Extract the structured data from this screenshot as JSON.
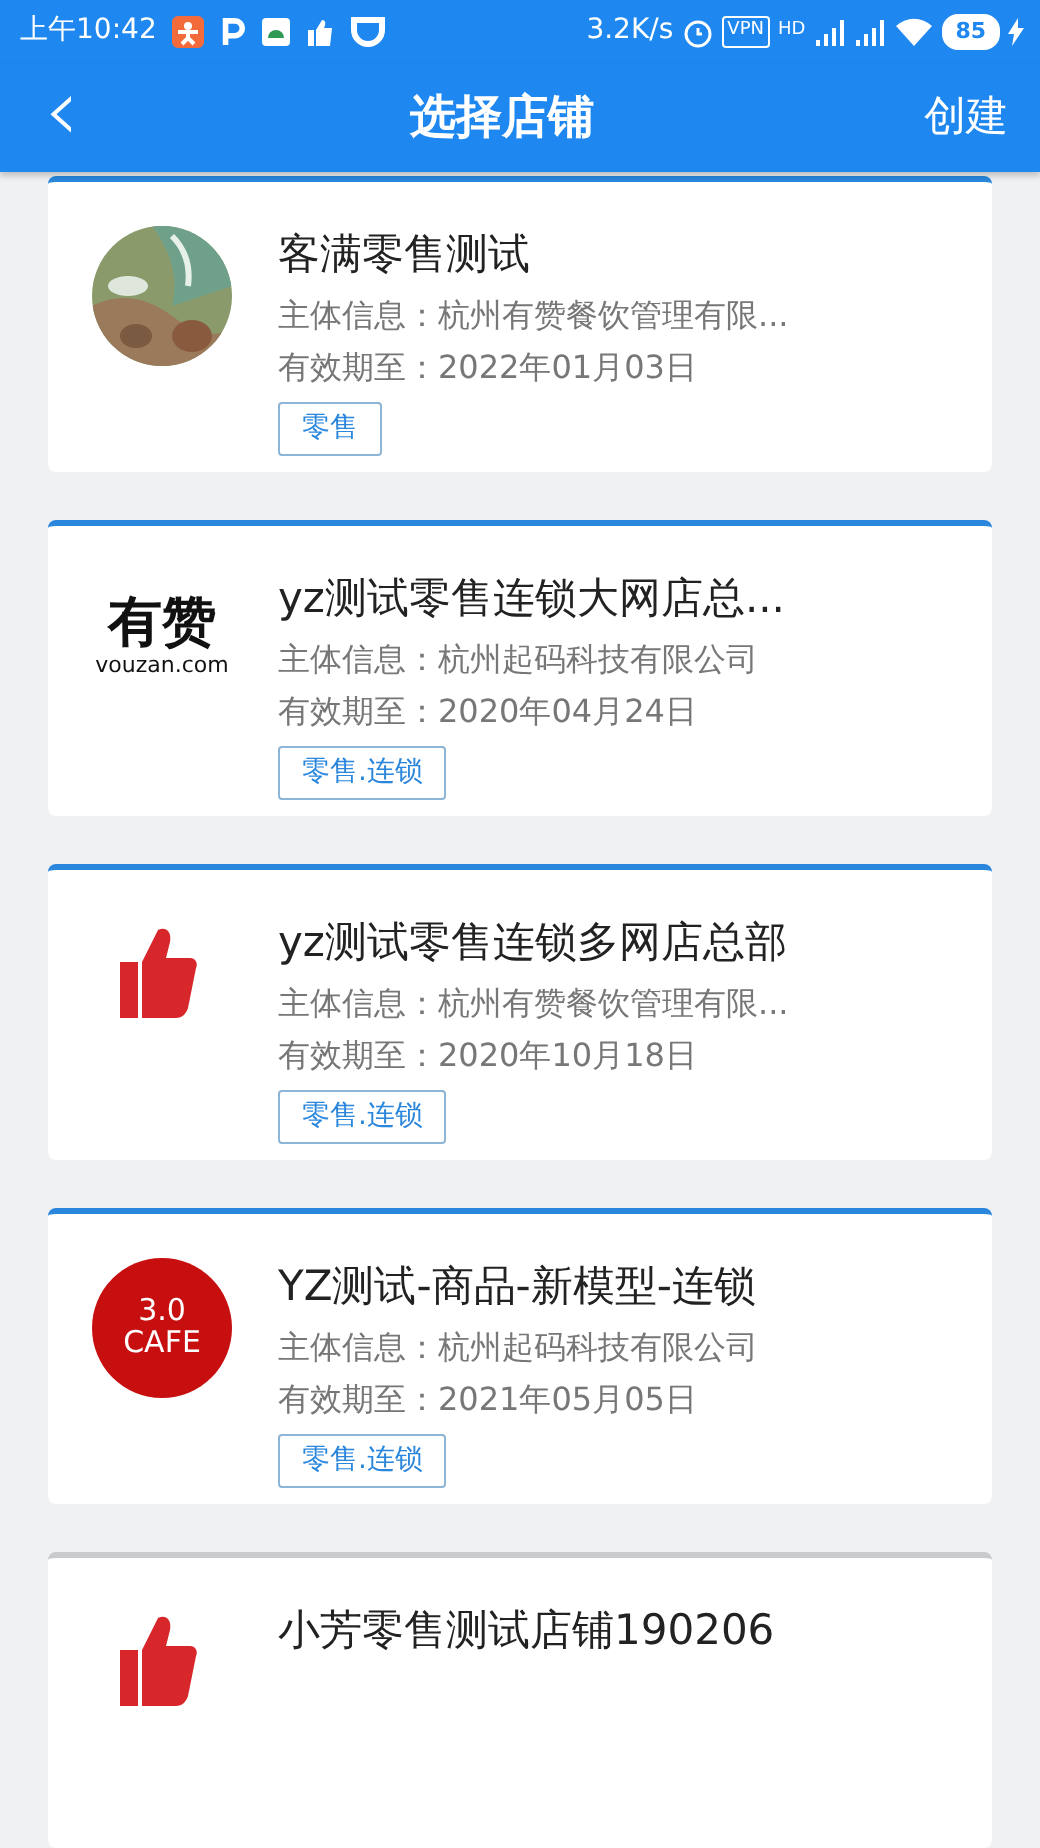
{
  "status_bar": {
    "time": "上午10:42",
    "speed": "3.2K/s",
    "vpn": "VPN",
    "hd": "HD",
    "battery": "85"
  },
  "header": {
    "back": "‹",
    "title": "选择店铺",
    "action": "创建"
  },
  "stores": [
    {
      "name": "客满零售测试",
      "entity": "主体信息：杭州有赞餐饮管理有限...",
      "expiry": "有效期至：2022年01月03日",
      "tag": "零售",
      "active": true
    },
    {
      "logo": {
        "kind": "wordmark",
        "text": "有赞",
        "subtext": "vouzan.com"
      },
      "name": "yz测试零售连锁大网店总...",
      "entity": "主体信息：杭州起码科技有限公司",
      "expiry": "有效期至：2020年04月24日",
      "tag": "零售.连锁",
      "active": true
    },
    {
      "logo": {
        "kind": "thumb"
      },
      "name": "yz测试零售连锁多网店总部",
      "entity": "主体信息：杭州有赞餐饮管理有限...",
      "expiry": "有效期至：2020年10月18日",
      "tag": "零售.连锁",
      "active": true
    },
    {
      "logo": {
        "kind": "badge",
        "text": "3.0",
        "subtext": "CAFE"
      },
      "name": "YZ测试-商品-新模型-连锁",
      "entity": "主体信息：杭州起码科技有限公司",
      "expiry": "有效期至：2021年05月05日",
      "tag": "零售.连锁",
      "active": true
    },
    {
      "logo": {
        "kind": "thumb"
      },
      "name": "小芳零售测试店铺190206",
      "active": false
    }
  ]
}
